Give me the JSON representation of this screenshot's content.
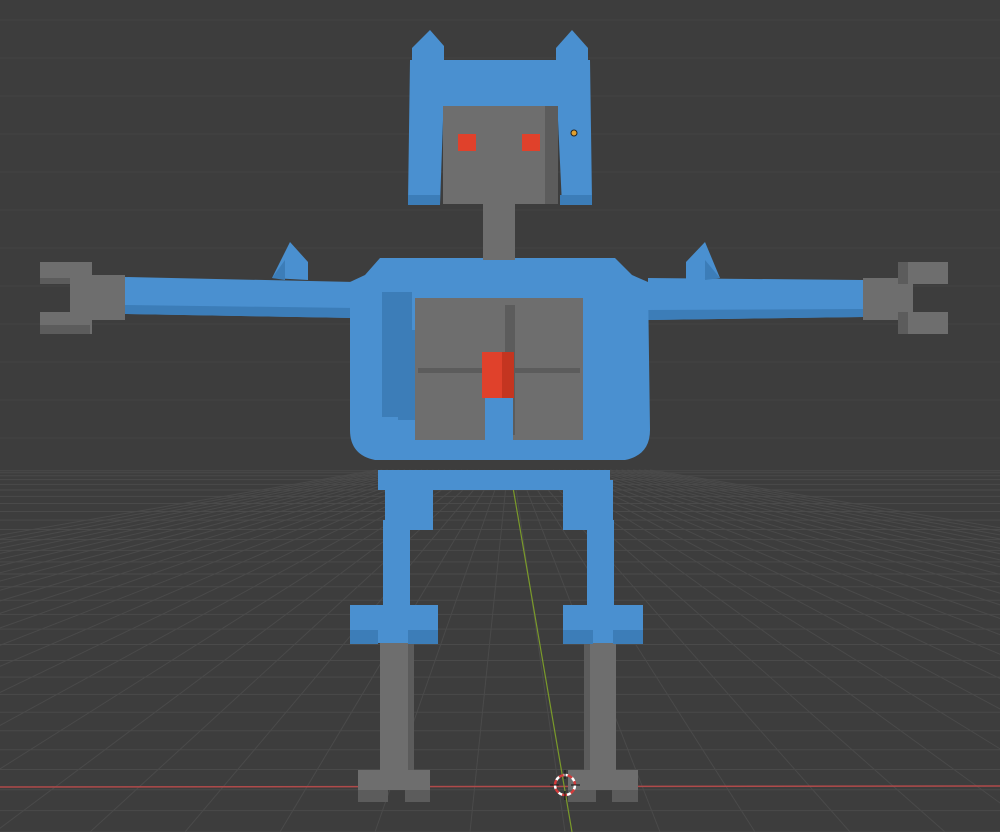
{
  "viewport": {
    "background": "#3d3d3d",
    "grid_color": "#4a4a4a",
    "x_axis_color": "#b04a4a",
    "y_axis_color": "#7a9a2a"
  },
  "model": {
    "name": "",
    "body_color": "#4a90d0",
    "body_shade": "#3c7db8",
    "metal_color": "#6e6e6e",
    "metal_shade": "#5c5c5c",
    "accent_color": "#e0412b"
  },
  "gizmos": {
    "origin": "origin-point-icon",
    "cursor": "3d-cursor-icon"
  }
}
